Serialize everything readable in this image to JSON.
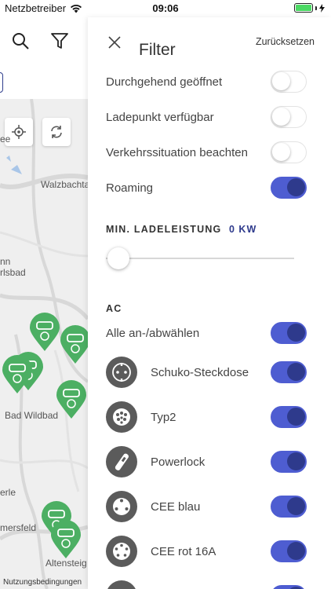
{
  "status_bar": {
    "carrier": "Netzbetreiber",
    "time": "09:06"
  },
  "map": {
    "labels": {
      "walzbachtal": "Walzbachta",
      "nn": "nn",
      "rlsbad": "rlsbad",
      "bad_wildbad": "Bad Wildbad",
      "erle": "erle",
      "mersfeld": "mersfeld",
      "altensteig": "Altensteig",
      "ee": "ee"
    },
    "footer_link": "Nutzungsbedingungen",
    "pin_color": "#4caf63"
  },
  "filter": {
    "title": "Filter",
    "reset_label": "Zurücksetzen",
    "toggles": [
      {
        "label": "Durchgehend geöffnet",
        "on": false
      },
      {
        "label": "Ladepunkt verfügbar",
        "on": false
      },
      {
        "label": "Verkehrssituation beachten",
        "on": false
      },
      {
        "label": "Roaming",
        "on": true
      }
    ],
    "min_power": {
      "title": "MIN. LADELEISTUNG",
      "value": "0 KW",
      "level": 0
    },
    "ac": {
      "title": "AC",
      "select_all": {
        "label": "Alle an-/abwählen",
        "on": true
      },
      "plugs": [
        {
          "label": "Schuko-Steckdose",
          "icon": "schuko-icon",
          "on": true
        },
        {
          "label": "Typ2",
          "icon": "type2-icon",
          "on": true
        },
        {
          "label": "Powerlock",
          "icon": "powerlock-icon",
          "on": true
        },
        {
          "label": "CEE blau",
          "icon": "cee-blue-icon",
          "on": true
        },
        {
          "label": "CEE rot 16A",
          "icon": "cee-red-icon",
          "on": true
        }
      ]
    },
    "accent_color": "#4e5dd1"
  }
}
